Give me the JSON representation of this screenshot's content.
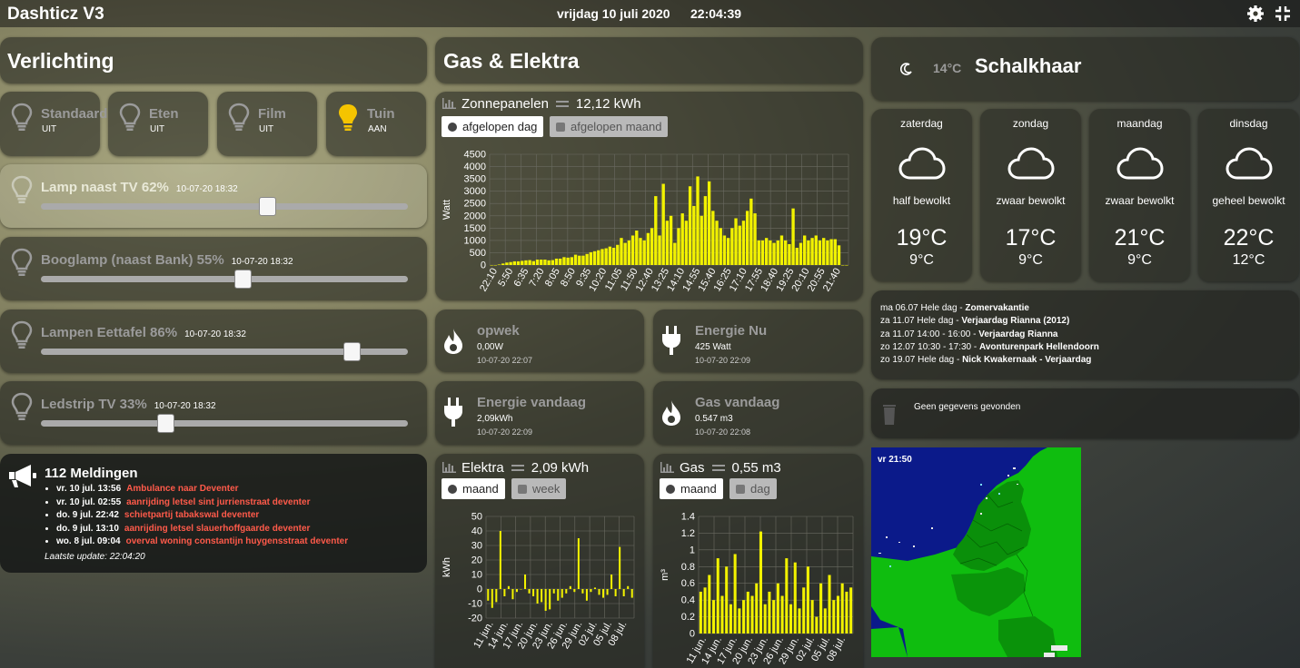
{
  "header": {
    "title": "Dashticz V3",
    "date": "vrijdag 10 juli 2020",
    "time": "22:04:39"
  },
  "lighting": {
    "title": "Verlichting",
    "switches": [
      {
        "label": "Standaard",
        "state": "UIT"
      },
      {
        "label": "Eten",
        "state": "UIT"
      },
      {
        "label": "Film",
        "state": "UIT"
      },
      {
        "label": "Tuin",
        "state": "AAN"
      }
    ],
    "dimmers": [
      {
        "label": "Lamp naast TV 62%",
        "time": "10-07-20 18:32",
        "level": 0.62
      },
      {
        "label": "Booglamp (naast Bank) 55%",
        "time": "10-07-20 18:32",
        "level": 0.55
      },
      {
        "label": "Lampen Eettafel 86%",
        "time": "10-07-20 18:32",
        "level": 0.86
      },
      {
        "label": "Ledstrip TV 33%",
        "time": "10-07-20 18:32",
        "level": 0.33
      }
    ]
  },
  "news": {
    "title": "112 Meldingen",
    "items": [
      {
        "date": "vr. 10 jul. 13:56",
        "text": "Ambulance naar Deventer"
      },
      {
        "date": "vr. 10 jul. 02:55",
        "text": "aanrijding letsel sint jurrienstraat deventer"
      },
      {
        "date": "do. 9 jul. 22:42",
        "text": "schietpartij tabakswal deventer"
      },
      {
        "date": "do. 9 jul. 13:10",
        "text": "aanrijding letsel slauerhoffgaarde deventer"
      },
      {
        "date": "wo. 8 jul. 09:04",
        "text": "overval woning constantijn huygensstraat deventer"
      }
    ],
    "last_update": "Laatste update: 22:04:20"
  },
  "energy": {
    "title": "Gas & Elektra",
    "solar": {
      "label": "Zonnepanelen",
      "value": "12,12 kWh",
      "btn_active": "afgelopen dag",
      "btn_inactive": "afgelopen maand",
      "ylabel": "Watt"
    },
    "devices": [
      {
        "title": "opwek",
        "value": "0,00W",
        "time": "10-07-20 22:07"
      },
      {
        "title": "Energie Nu",
        "value": "425 Watt",
        "time": "10-07-20 22:09"
      },
      {
        "title": "Energie vandaag",
        "value": "2,09kWh",
        "time": "10-07-20 22:09"
      },
      {
        "title": "Gas vandaag",
        "value": "0.547 m3",
        "time": "10-07-20 22:08"
      }
    ],
    "elektra": {
      "label": "Elektra",
      "value": "2,09 kWh",
      "btn_active": "maand",
      "btn_inactive": "week",
      "ylabel": "kWh"
    },
    "gas": {
      "label": "Gas",
      "value": "0,55 m3",
      "btn_active": "maand",
      "btn_inactive": "dag",
      "ylabel": "m³"
    }
  },
  "weather": {
    "current_temp": "14°C",
    "location": "Schalkhaar",
    "days": [
      {
        "name": "zaterdag",
        "desc": "half bewolkt",
        "high": "19°C",
        "low": "9°C"
      },
      {
        "name": "zondag",
        "desc": "zwaar bewolkt",
        "high": "17°C",
        "low": "9°C"
      },
      {
        "name": "maandag",
        "desc": "zwaar bewolkt",
        "high": "21°C",
        "low": "9°C"
      },
      {
        "name": "dinsdag",
        "desc": "geheel bewolkt",
        "high": "22°C",
        "low": "12°C"
      }
    ]
  },
  "agenda": [
    {
      "when": "ma 06.07 Hele dag - ",
      "what": "Zomervakantie"
    },
    {
      "when": "za 11.07 Hele dag - ",
      "what": "Verjaardag Rianna (2012)"
    },
    {
      "when": "za 11.07 14:00 - 16:00 - ",
      "what": "Verjaardag Rianna"
    },
    {
      "when": "zo 12.07 10:30 - 17:30 - ",
      "what": "Avonturenpark Hellendoorn"
    },
    {
      "when": "zo 19.07 Hele dag - ",
      "what": "Nick Kwakernaak - Verjaardag"
    }
  ],
  "garbage": {
    "text": "Geen gegevens gevonden"
  },
  "radar": {
    "time": "vr 21:50"
  },
  "colors": {
    "bar": "#f2f200",
    "accent_bulb": "#f5c400",
    "news_red": "#ff5a4a"
  },
  "chart_data": [
    {
      "type": "bar",
      "ylabel": "Watt",
      "ylim": [
        0,
        4500
      ],
      "yticks": [
        0,
        500,
        1000,
        1500,
        2000,
        2500,
        3000,
        3500,
        4000,
        4500
      ],
      "categories": [
        "22:10",
        "5:50",
        "6:35",
        "7:20",
        "8:05",
        "8:50",
        "9:35",
        "10:20",
        "11:05",
        "11:50",
        "12:40",
        "13:25",
        "14:10",
        "14:55",
        "15:40",
        "16:25",
        "17:10",
        "17:55",
        "18:40",
        "19:25",
        "20:10",
        "20:55",
        "21:40"
      ],
      "values": [
        0,
        0,
        20,
        60,
        100,
        120,
        150,
        150,
        170,
        190,
        200,
        160,
        220,
        220,
        220,
        190,
        200,
        260,
        260,
        320,
        300,
        320,
        420,
        380,
        380,
        450,
        520,
        560,
        600,
        650,
        680,
        750,
        700,
        820,
        1100,
        900,
        1000,
        1200,
        1400,
        1100,
        1000,
        1300,
        1500,
        2800,
        1200,
        3300,
        1800,
        2000,
        900,
        1500,
        2100,
        1800,
        3200,
        2400,
        3600,
        2000,
        2800,
        3400,
        2200,
        1800,
        1500,
        1200,
        1100,
        1500,
        1900,
        1600,
        1800,
        2200,
        2700,
        2100,
        1000,
        1000,
        1100,
        1000,
        900,
        1000,
        1200,
        1000,
        850,
        2300,
        700,
        900,
        1200,
        1000,
        1100,
        1200,
        1000,
        1100,
        1000,
        1050,
        1050,
        800,
        0,
        0
      ]
    },
    {
      "type": "bar",
      "ylabel": "kWh",
      "ylim": [
        -20,
        50
      ],
      "yticks": [
        -20,
        -10,
        0,
        10,
        20,
        30,
        40,
        50
      ],
      "categories": [
        "11 jun.",
        "14 jun.",
        "17 jun.",
        "20 jun.",
        "23 jun.",
        "26 jun.",
        "29 jun.",
        "02 jul.",
        "05 jul.",
        "08 jul."
      ],
      "values": [
        -8,
        -13,
        -9,
        40,
        -5,
        2,
        -7,
        -2,
        0,
        10,
        -3,
        -5,
        -10,
        -9,
        -15,
        -14,
        -3,
        -8,
        -6,
        -3,
        2,
        -2,
        35,
        -3,
        -8,
        -2,
        1,
        -4,
        -6,
        -4,
        10,
        -5,
        29,
        -5,
        2,
        -6
      ]
    },
    {
      "type": "bar",
      "ylabel": "m³",
      "ylim": [
        0,
        1.4
      ],
      "yticks": [
        0,
        0.2,
        0.4,
        0.6,
        0.8,
        1.0,
        1.2,
        1.4
      ],
      "categories": [
        "11 jun.",
        "14 jun.",
        "17 jun.",
        "20 jun.",
        "23 jun.",
        "26 jun.",
        "29 jun.",
        "02 jul.",
        "05 jul.",
        "08 jul."
      ],
      "values": [
        0.5,
        0.55,
        0.7,
        0.4,
        0.9,
        0.45,
        0.8,
        0.35,
        0.95,
        0.3,
        0.4,
        0.5,
        0.45,
        0.6,
        1.22,
        0.35,
        0.5,
        0.4,
        0.6,
        0.45,
        0.9,
        0.35,
        0.85,
        0.3,
        0.55,
        0.8,
        0.4,
        0.2,
        0.6,
        0.3,
        0.7,
        0.4,
        0.45,
        0.6,
        0.5,
        0.55
      ]
    }
  ]
}
